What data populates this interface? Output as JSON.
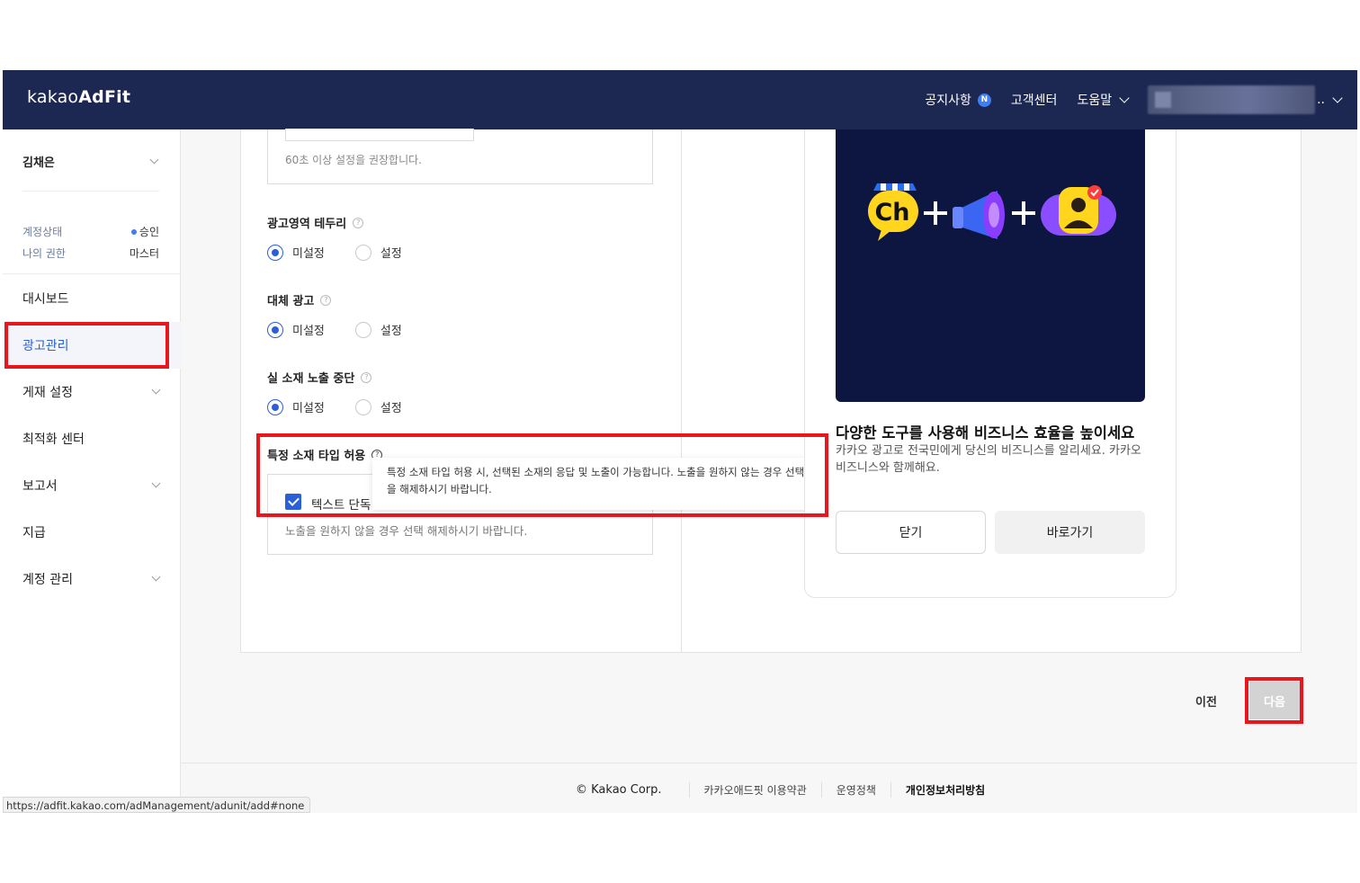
{
  "header": {
    "logo_light": "kakao",
    "logo_bold": "AdFit",
    "notice": "공지사항",
    "notice_badge": "N",
    "support": "고객센터",
    "help": "도움말",
    "user_dots": ".."
  },
  "sidebar": {
    "user_name": "김채은",
    "account_status_label": "계정상태",
    "account_status_value": "승인",
    "my_role_label": "나의 권한",
    "my_role_value": "마스터",
    "items": [
      {
        "label": "대시보드"
      },
      {
        "label": "광고관리"
      },
      {
        "label": "게재 설정"
      },
      {
        "label": "최적화 센터"
      },
      {
        "label": "보고서"
      },
      {
        "label": "지급"
      },
      {
        "label": "계정 관리"
      }
    ]
  },
  "form": {
    "interval_hint": "60초 이상 설정을 권장합니다.",
    "border": {
      "title": "광고영역 테두리",
      "off": "미설정",
      "on": "설정"
    },
    "fallback": {
      "title": "대체 광고",
      "off": "미설정",
      "on": "설정"
    },
    "stop": {
      "title": "실 소재 노출 중단",
      "off": "미설정",
      "on": "설정"
    },
    "creative": {
      "title": "특정 소재 타입 허용",
      "checkbox_label": "텍스트 단독",
      "hint": "노출을 원하지 않을 경우 선택 해제하시기 바랍니다.",
      "tooltip": "특정 소재 타입 허용 시, 선택된 소재의 응답 및 노출이 가능합니다. 노출을 원하지 않는 경우 선택을 해제하시기 바랍니다."
    }
  },
  "promo": {
    "title": "다양한 도구를 사용해 비즈니스 효율을 높이세요",
    "desc": "카카오 광고로 전국민에게 당신의 비즈니스를 알리세요. 카카오 비즈니스와 함께해요.",
    "ch_text": "Ch",
    "close": "닫기",
    "go": "바로가기"
  },
  "actions": {
    "prev": "이전",
    "next": "다음"
  },
  "footer": {
    "copyright": "© Kakao Corp.",
    "terms": "카카오애드핏 이용약관",
    "policy": "운영정책",
    "privacy": "개인정보처리방침"
  },
  "status_url": "https://adfit.kakao.com/adManagement/adunit/add#none",
  "colors": {
    "header_bg": "#1c2752",
    "accent": "#2b5fd8",
    "highlight": "#e8161d"
  }
}
